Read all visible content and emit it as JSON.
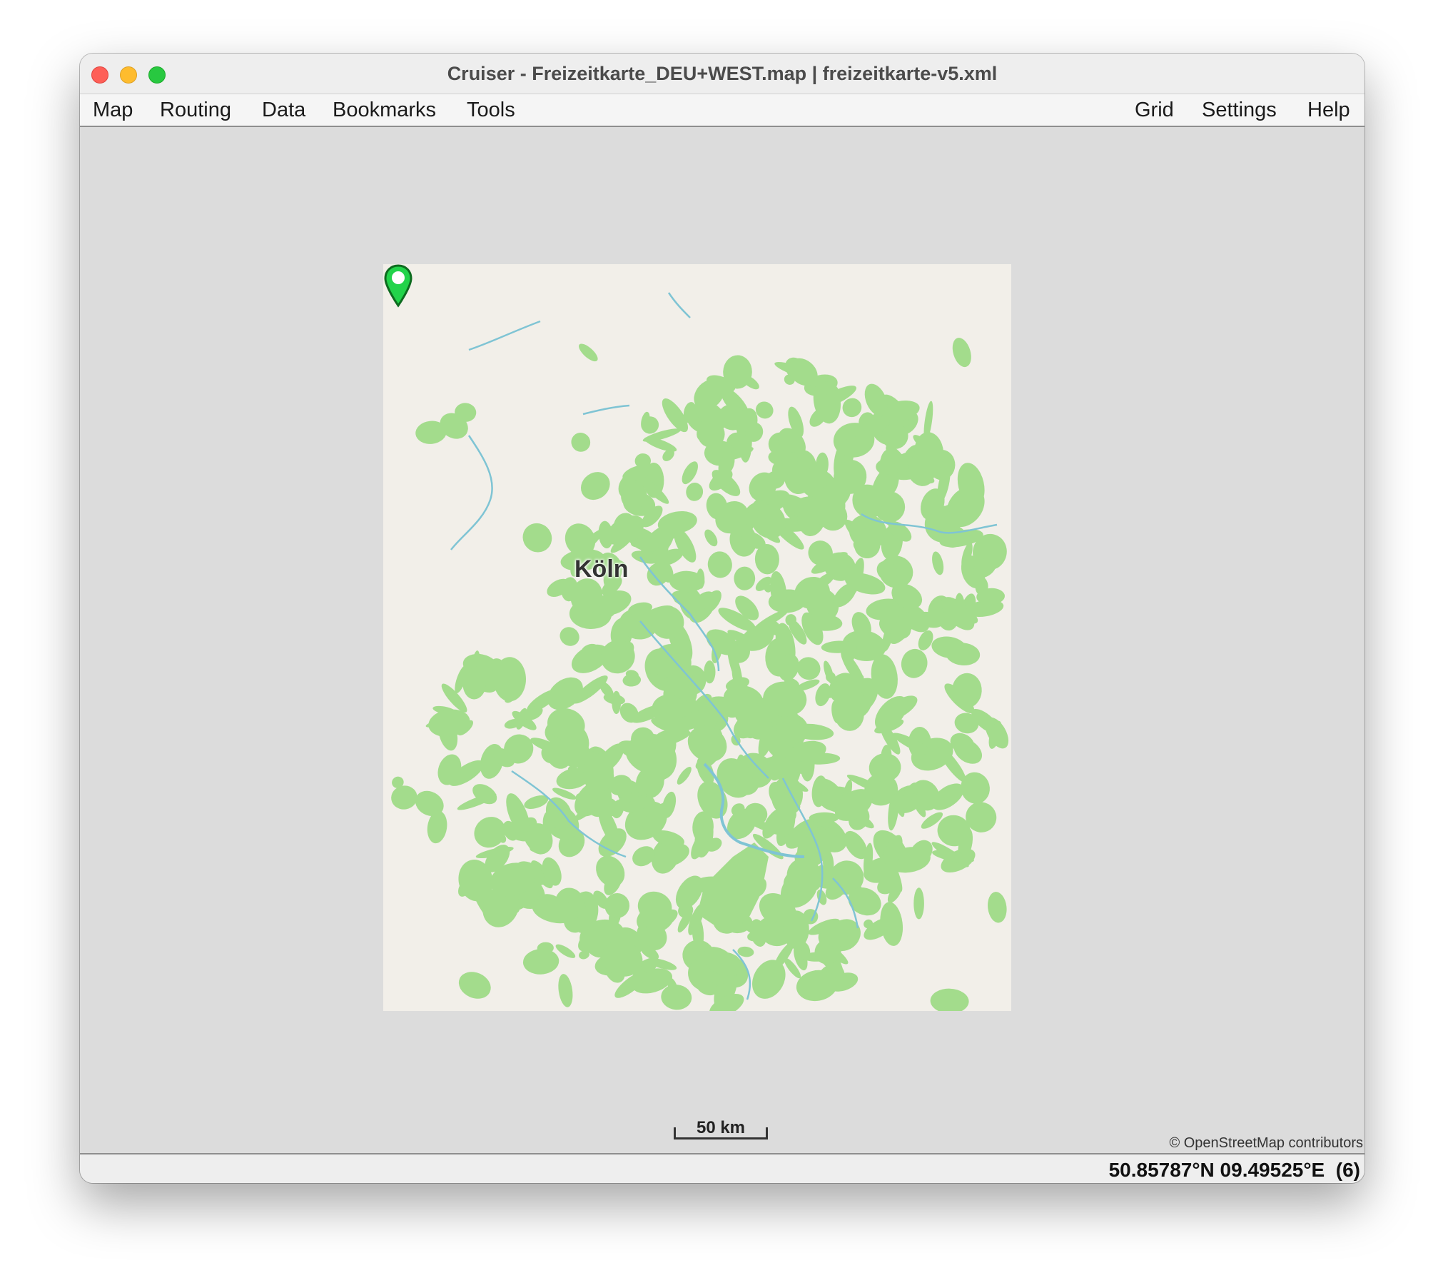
{
  "window": {
    "title": "Cruiser - Freizeitkarte_DEU+WEST.map | freizeitkarte-v5.xml"
  },
  "menu": {
    "left": [
      "Map",
      "Routing",
      "Data",
      "Bookmarks",
      "Tools"
    ],
    "right": [
      "Grid",
      "Settings",
      "Help"
    ]
  },
  "map": {
    "city_label": "Köln",
    "scale_label": "50 km",
    "attribution": "© OpenStreetMap contributors",
    "marker_icon": "map-pin-icon",
    "colors": {
      "background": "#dcdcdc",
      "land": "#f2efe9",
      "forest": "#a3dc8c",
      "water": "#7fc4d4",
      "marker": "#22d34a"
    }
  },
  "status": {
    "coordinates": "50.85787°N 09.49525°E  (6)"
  }
}
